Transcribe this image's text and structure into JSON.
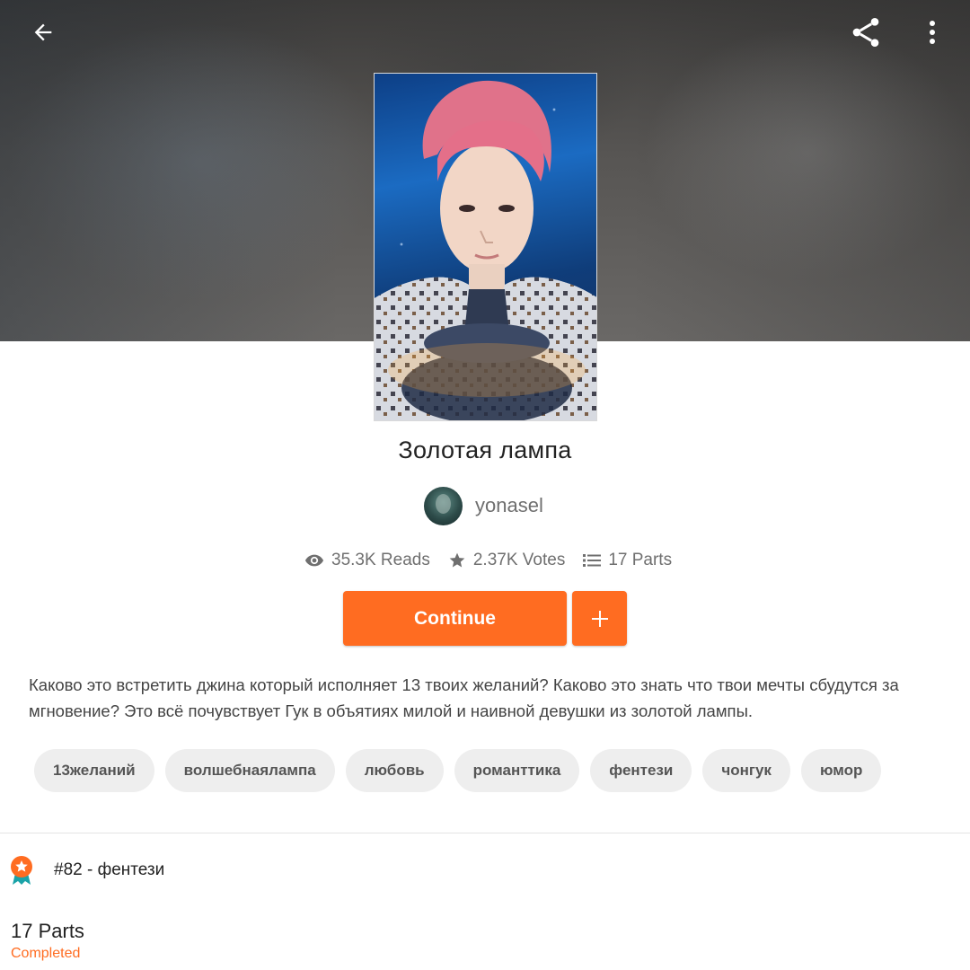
{
  "story": {
    "title": "Золотая лампа",
    "author": "yonasel",
    "description": "Каково это встретить джина который исполняет 13 твоих желаний? Каково это знать что твои мечты сбудутся за мгновение? Это всё почувствует Гук в объятиях милой и наивной девушки из золотой лампы."
  },
  "stats": {
    "reads": "35.3K Reads",
    "votes": "2.37K Votes",
    "parts": "17 Parts"
  },
  "actions": {
    "continue_label": "Continue",
    "add_label": "+"
  },
  "tags": [
    "13желаний",
    "волшебнаялампа",
    "любовь",
    "романттика",
    "фентези",
    "чонгук",
    "юмор"
  ],
  "ranking": {
    "label": "#82 - фентези"
  },
  "parts_section": {
    "count_label": "17 Parts",
    "status": "Completed"
  },
  "icons": {
    "back": "arrow-left-icon",
    "share": "share-icon",
    "more": "more-vertical-icon",
    "reads": "eye-icon",
    "votes": "star-icon",
    "parts": "list-icon",
    "ranking": "ribbon-badge-icon"
  },
  "colors": {
    "accent": "#ff6c21",
    "tag_bg": "#eeeeee"
  }
}
